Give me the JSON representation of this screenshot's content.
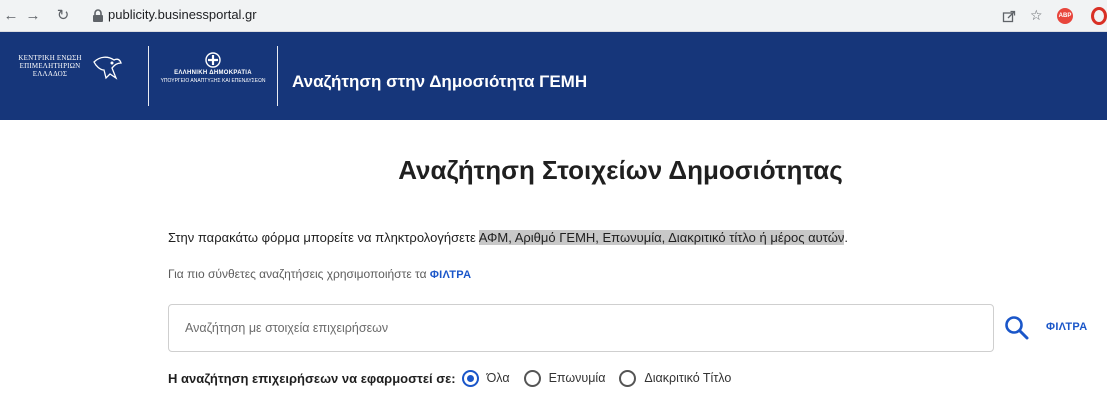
{
  "browser": {
    "url": "publicity.businessportal.gr",
    "back_icon": "arrow-left",
    "forward_icon": "arrow-right",
    "reload_icon": "reload",
    "share_icon": "share",
    "star_icon": "star",
    "ext1_label": "ABP"
  },
  "header": {
    "logo1_text": "ΚΕΝΤΡΙΚΗ ΕΝΩΣΗ ΕΠΙΜΕΛΗΤΗΡΙΩΝ ΕΛΛΑΔΟΣ",
    "logo2_line1": "ΕΛΛΗΝΙΚΗ ΔΗΜΟΚΡΑΤΙΑ",
    "logo2_line2": "ΥΠΟΥΡΓΕΙΟ ΑΝΑΠΤΥΞΗΣ ΚΑΙ ΕΠΕΝΔΥΣΕΩΝ",
    "title": "Αναζήτηση στην Δημοσιότητα ΓΕΜΗ",
    "color": "#16367a"
  },
  "main": {
    "title": "Αναζήτηση Στοιχείων Δημοσιότητας",
    "intro_before": "Στην παρακάτω φόρμα μπορείτε να πληκτρολογήσετε ",
    "intro_highlight": "ΑΦΜ, Αριθμό ΓΕΜΗ, Επωνυμία, Διακριτικό τίτλο ή μέρος αυτών",
    "intro_after": ".",
    "hint_text": "Για πιο σύνθετες αναζητήσεις χρησιμοποιήστε τα ",
    "filters_label": "ΦΙΛΤΡΑ",
    "search_placeholder": "Αναζήτηση με στοιχεία επιχειρήσεων",
    "search_value": "",
    "search_icon": "magnifier",
    "filters_button_label": "ΦΙΛΤΡΑ",
    "scope_label": "Η αναζήτηση επιχειρήσεων να εφαρμοστεί σε:",
    "scope_options": [
      {
        "label": "Όλα",
        "selected": true
      },
      {
        "label": "Επωνυμία",
        "selected": false
      },
      {
        "label": "Διακριτικό Τίτλο",
        "selected": false
      }
    ],
    "accent_color": "#1a56c9"
  }
}
